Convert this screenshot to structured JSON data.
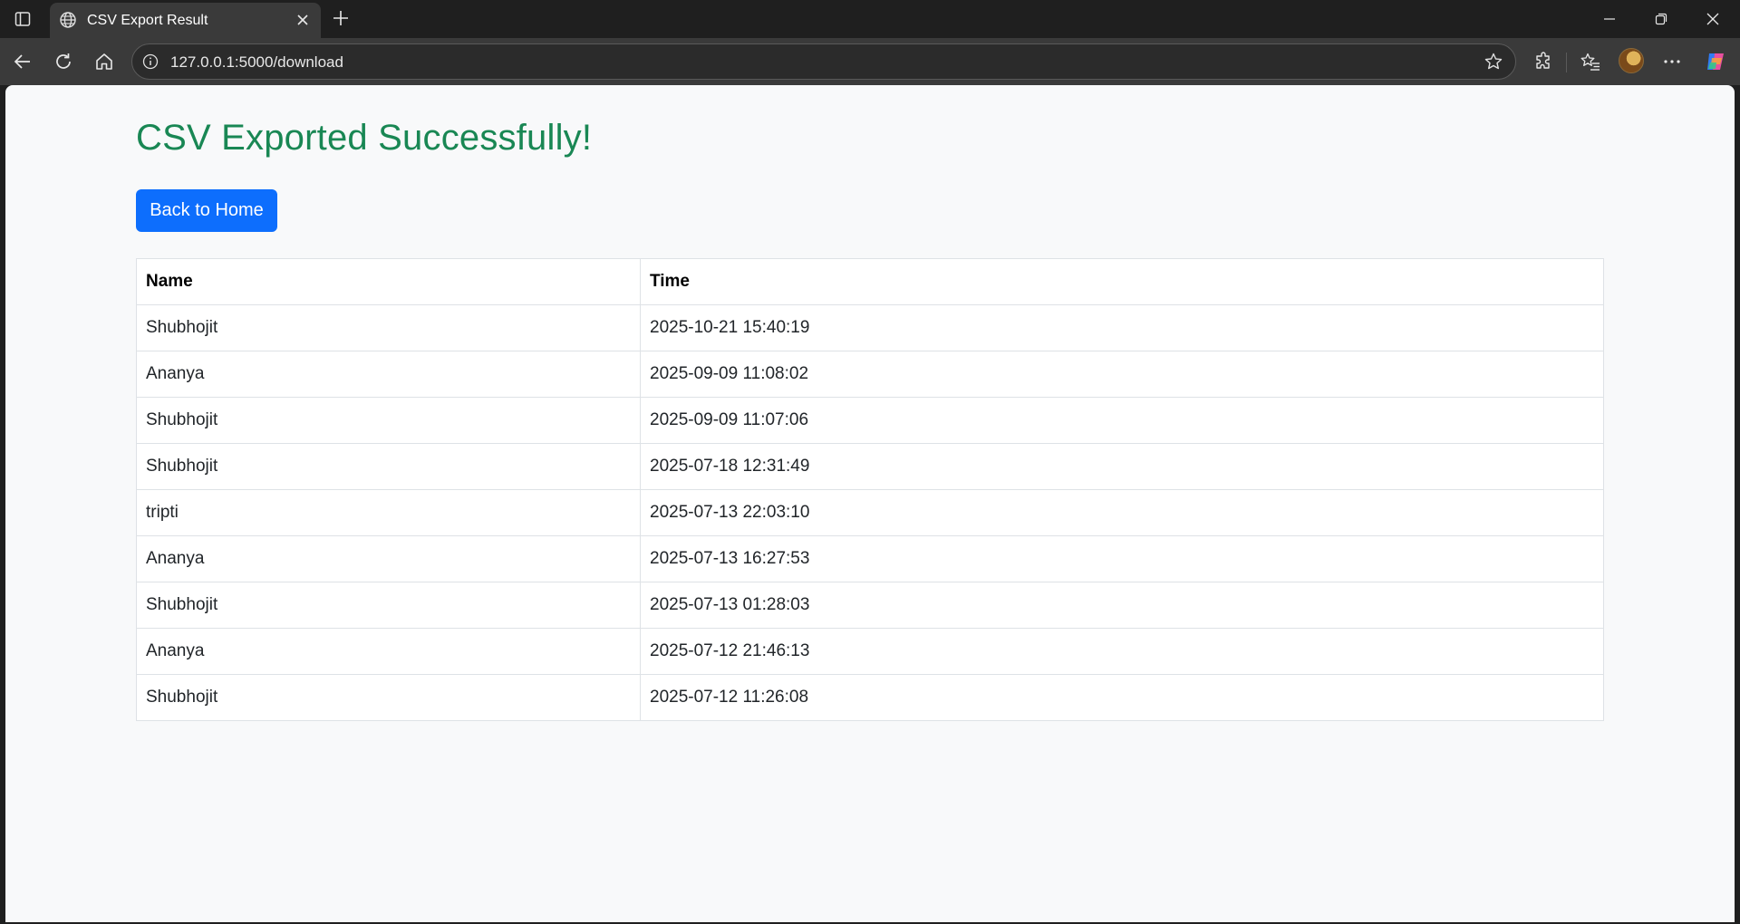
{
  "browser": {
    "tab_title": "CSV Export Result",
    "url": "127.0.0.1:5000/download"
  },
  "page": {
    "title": "CSV Exported Successfully!",
    "home_button_label": "Back to Home",
    "table": {
      "headers": [
        "Name",
        "Time"
      ],
      "rows": [
        [
          "Shubhojit",
          "2025-10-21 15:40:19"
        ],
        [
          "Ananya",
          "2025-09-09 11:08:02"
        ],
        [
          "Shubhojit",
          "2025-09-09 11:07:06"
        ],
        [
          "Shubhojit",
          "2025-07-18 12:31:49"
        ],
        [
          "tripti",
          "2025-07-13 22:03:10"
        ],
        [
          "Ananya",
          "2025-07-13 16:27:53"
        ],
        [
          "Shubhojit",
          "2025-07-13 01:28:03"
        ],
        [
          "Ananya",
          "2025-07-12 21:46:13"
        ],
        [
          "Shubhojit",
          "2025-07-12 11:26:08"
        ]
      ]
    }
  },
  "colors": {
    "title_green": "#198754",
    "button_blue": "#0d6efd",
    "page_background": "#f8f9fa"
  }
}
